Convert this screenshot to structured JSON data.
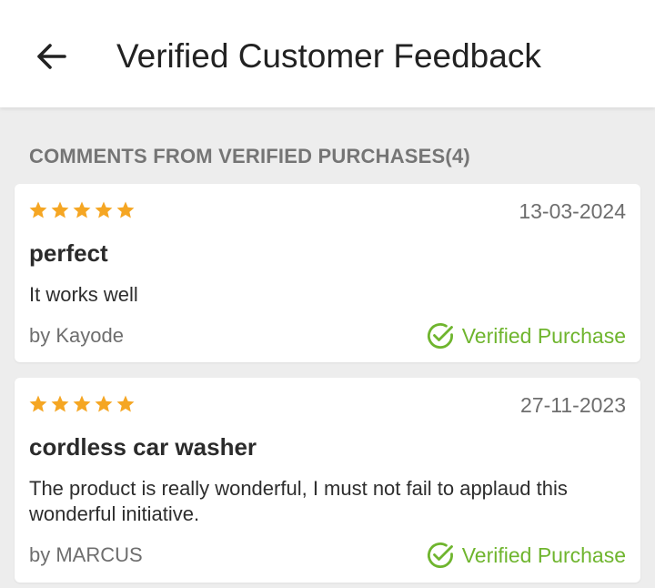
{
  "header": {
    "back_icon": "arrow-left-icon",
    "title": "Verified Customer Feedback"
  },
  "section": {
    "label": "COMMENTS FROM VERIFIED PURCHASES(4)"
  },
  "colors": {
    "star": "#f5a623",
    "verified": "#6fb52e",
    "background": "#ededed"
  },
  "reviews": [
    {
      "rating": 5,
      "date": "13-03-2024",
      "title": "perfect",
      "body": "It works well",
      "author": "by Kayode",
      "verified_label": "Verified Purchase",
      "verified_icon": "check-circle-icon"
    },
    {
      "rating": 5,
      "date": "27-11-2023",
      "title": "cordless car washer",
      "body": "The product is really wonderful, I must not fail to applaud this wonderful initiative.",
      "author": "by MARCUS",
      "verified_label": "Verified Purchase",
      "verified_icon": "check-circle-icon"
    }
  ]
}
